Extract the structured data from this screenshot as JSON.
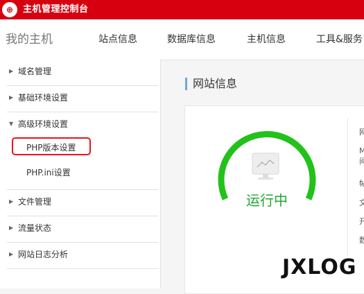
{
  "topbar": {
    "logo_glyph": "⊕",
    "title": "主机管理控制台"
  },
  "nav": {
    "brand": "我的主机",
    "items": [
      "站点信息",
      "数据库信息",
      "主机信息",
      "工具&服务"
    ]
  },
  "sidebar": {
    "items": [
      {
        "label": "域名管理",
        "arrow": "▶"
      },
      {
        "label": "基础环境设置",
        "arrow": "▶"
      },
      {
        "label": "高级环境设置",
        "arrow": "▼"
      },
      {
        "label": "文件管理",
        "arrow": "▶"
      },
      {
        "label": "流量状态",
        "arrow": "▶"
      },
      {
        "label": "网站日志分析",
        "arrow": "▶"
      }
    ],
    "subitems": [
      "PHP版本设置",
      "PHP.ini设置"
    ]
  },
  "main": {
    "title": "网站信息",
    "status": "运行中",
    "right_fragments": [
      "网",
      "M",
      "间",
      "帖",
      "文",
      "开",
      "数"
    ]
  },
  "colors": {
    "brand_red": "#d7000f",
    "running_green": "#1fa82e",
    "gauge_green": "#22c21a",
    "highlight_red": "#e8141c"
  },
  "watermark": "JXLOG"
}
